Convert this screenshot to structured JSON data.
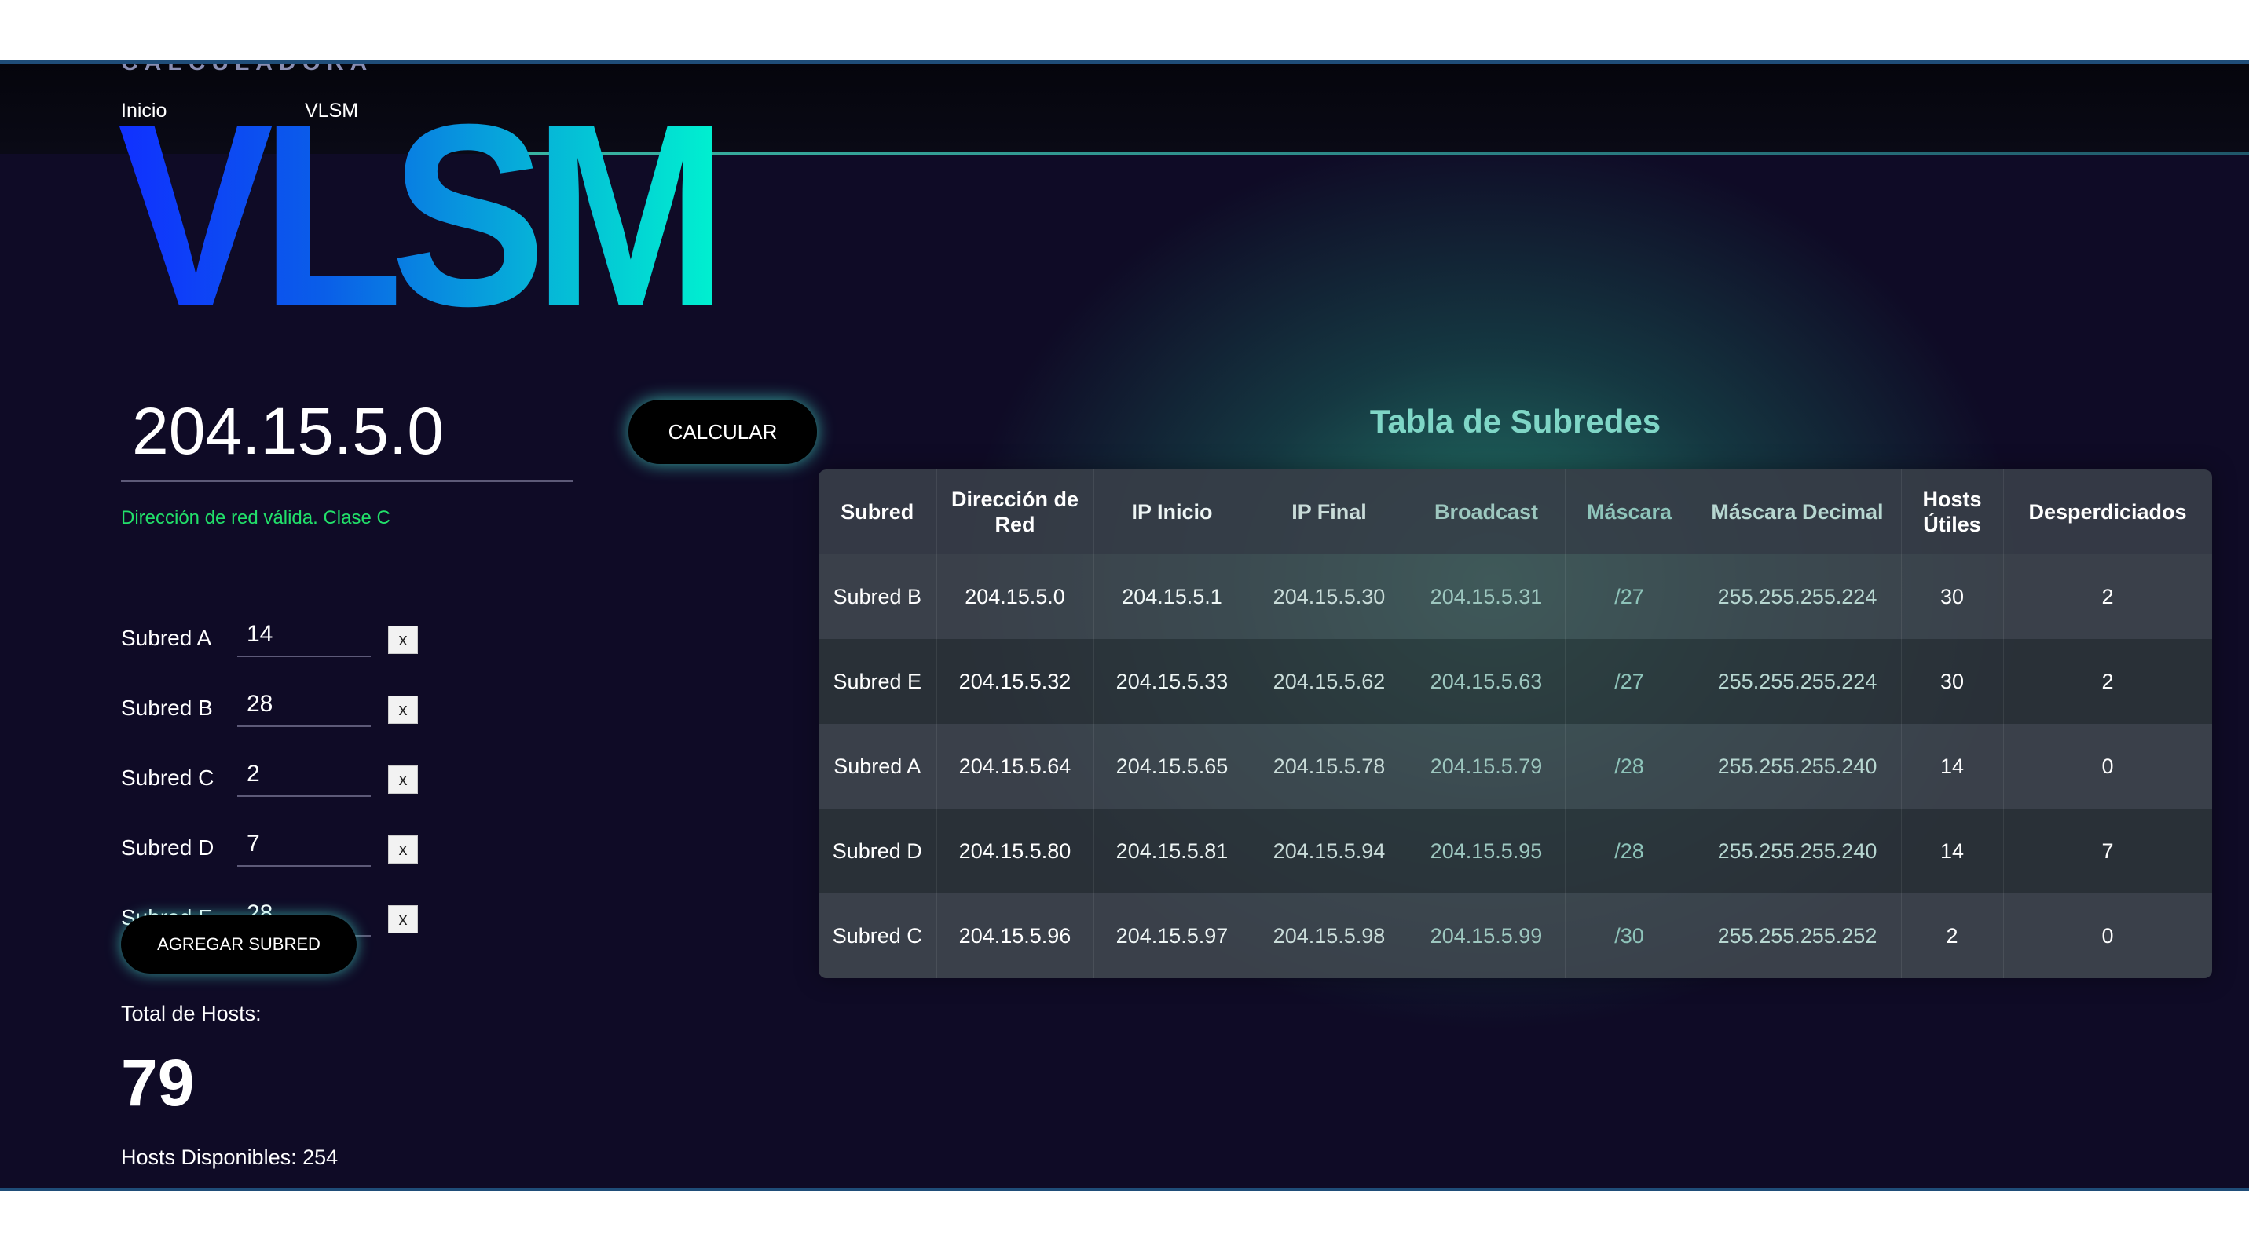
{
  "nav": {
    "brand_small": "CALCULADORA",
    "links": [
      "Inicio",
      "VLSM"
    ],
    "logo": "VLSM"
  },
  "form": {
    "network_ip": "204.15.5.0",
    "calc_label": "CALCULAR",
    "valid_message": "Dirección de red válida. Clase C",
    "subnets": [
      {
        "label": "Subred A",
        "value": "14",
        "remove": "x"
      },
      {
        "label": "Subred B",
        "value": "28",
        "remove": "x"
      },
      {
        "label": "Subred C",
        "value": "2",
        "remove": "x"
      },
      {
        "label": "Subred D",
        "value": "7",
        "remove": "x"
      },
      {
        "label": "Subred E",
        "value": "28",
        "remove": "x"
      }
    ],
    "add_label": "AGREGAR SUBRED",
    "total_label": "Total de Hosts:",
    "total_value": "79",
    "available_label": "Hosts Disponibles: 254"
  },
  "table": {
    "title": "Tabla de Subredes",
    "headers": [
      "Subred",
      "Dirección de Red",
      "IP Inicio",
      "IP Final",
      "Broadcast",
      "Máscara",
      "Máscara Decimal",
      "Hosts Útiles",
      "Desperdiciados"
    ],
    "rows": [
      [
        "Subred B",
        "204.15.5.0",
        "204.15.5.1",
        "204.15.5.30",
        "204.15.5.31",
        "/27",
        "255.255.255.224",
        "30",
        "2"
      ],
      [
        "Subred E",
        "204.15.5.32",
        "204.15.5.33",
        "204.15.5.62",
        "204.15.5.63",
        "/27",
        "255.255.255.224",
        "30",
        "2"
      ],
      [
        "Subred A",
        "204.15.5.64",
        "204.15.5.65",
        "204.15.5.78",
        "204.15.5.79",
        "/28",
        "255.255.255.240",
        "14",
        "0"
      ],
      [
        "Subred D",
        "204.15.5.80",
        "204.15.5.81",
        "204.15.5.94",
        "204.15.5.95",
        "/28",
        "255.255.255.240",
        "14",
        "7"
      ],
      [
        "Subred C",
        "204.15.5.96",
        "204.15.5.97",
        "204.15.5.98",
        "204.15.5.99",
        "/30",
        "255.255.255.252",
        "2",
        "0"
      ]
    ]
  },
  "colors": {
    "background": "#0f0b26",
    "accent": "#46dcc8",
    "valid": "#22e06a",
    "title": "#7fd6c6"
  }
}
